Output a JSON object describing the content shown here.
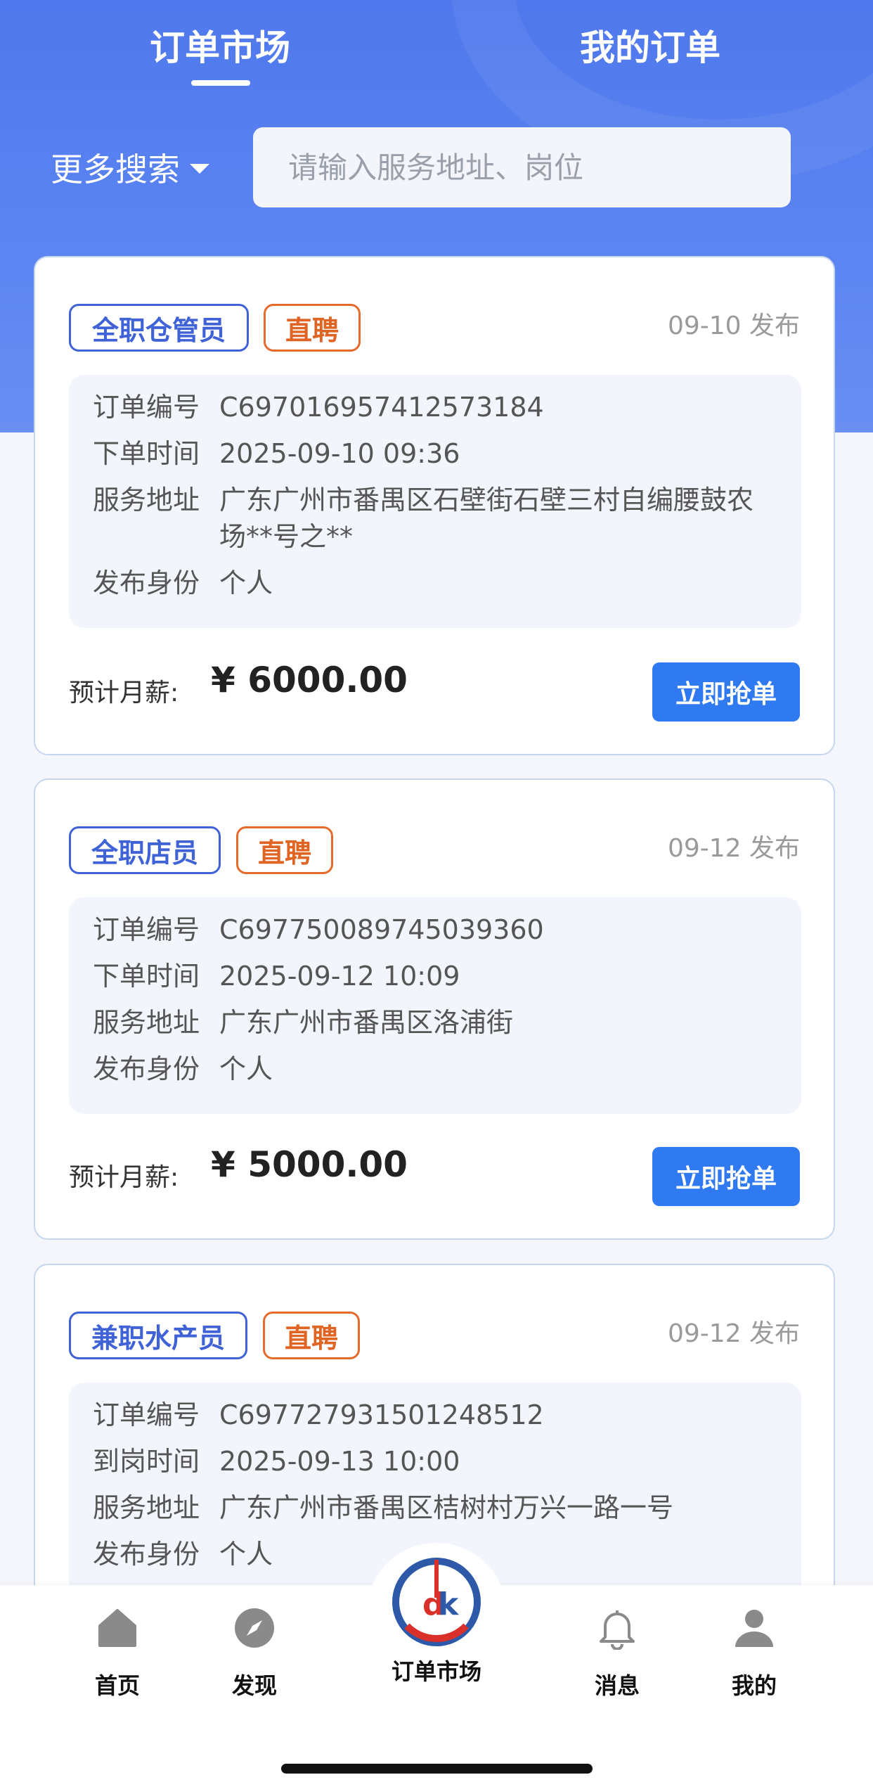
{
  "header": {
    "tabs": [
      {
        "label": "订单市场",
        "active": true
      },
      {
        "label": "我的订单",
        "active": false
      }
    ],
    "more_search_label": "更多搜索",
    "search_placeholder": "请输入服务地址、岗位"
  },
  "colors": {
    "brand_blue": "#4f78ec",
    "tag_blue": "#3f62d6",
    "tag_orange": "#e56b2c",
    "button_blue": "#2f7af0"
  },
  "orders": [
    {
      "role_tag": "全职仓管员",
      "hire_tag": "直聘",
      "published": "09-10 发布",
      "fields": [
        {
          "label": "订单编号",
          "value": "C697016957412573184"
        },
        {
          "label": "下单时间",
          "value": "2025-09-10 09:36"
        },
        {
          "label": "服务地址",
          "value": "广东广州市番禺区石壁街石壁三村自编腰鼓农场**号之**"
        },
        {
          "label": "发布身份",
          "value": "个人"
        }
      ],
      "salary_label": "预计月薪:",
      "salary_value": "¥ 6000.00",
      "button_label": "立即抢单"
    },
    {
      "role_tag": "全职店员",
      "hire_tag": "直聘",
      "published": "09-12 发布",
      "fields": [
        {
          "label": "订单编号",
          "value": "C697750089745039360"
        },
        {
          "label": "下单时间",
          "value": "2025-09-12 10:09"
        },
        {
          "label": "服务地址",
          "value": "广东广州市番禺区洛浦街"
        },
        {
          "label": "发布身份",
          "value": "个人"
        }
      ],
      "salary_label": "预计月薪:",
      "salary_value": "¥ 5000.00",
      "button_label": "立即抢单"
    },
    {
      "role_tag": "兼职水产员",
      "hire_tag": "直聘",
      "published": "09-12 发布",
      "fields": [
        {
          "label": "订单编号",
          "value": "C697727931501248512"
        },
        {
          "label": "到岗时间",
          "value": "2025-09-13 10:00"
        },
        {
          "label": "服务地址",
          "value": "广东广州市番禺区桔树村万兴一路一号"
        },
        {
          "label": "发布身份",
          "value": "个人"
        }
      ]
    }
  ],
  "tabbar": {
    "items": [
      {
        "label": "首页",
        "icon": "home-icon"
      },
      {
        "label": "发现",
        "icon": "compass-icon"
      },
      {
        "label": "订单市场",
        "icon": "dk-logo-icon",
        "center": true
      },
      {
        "label": "消息",
        "icon": "bell-icon"
      },
      {
        "label": "我的",
        "icon": "user-icon"
      }
    ]
  }
}
